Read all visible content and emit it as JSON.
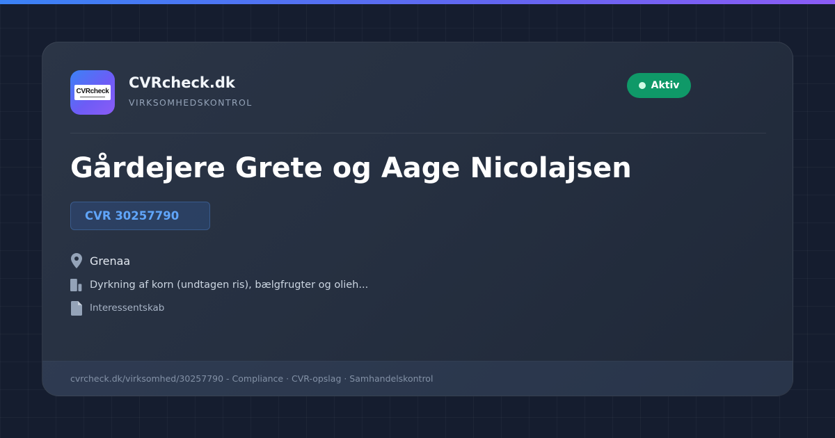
{
  "brand": {
    "logo_text": "CVRcheck",
    "name": "CVRcheck.dk",
    "tagline": "VIRKSOMHEDSKONTROL"
  },
  "status": {
    "label": "Aktiv",
    "color": "#0f9968"
  },
  "company": {
    "name": "Gårdejere Grete og Aage Nicolajsen",
    "cvr": "CVR 30257790",
    "city": "Grenaa",
    "industry": "Dyrkning af korn (undtagen ris), bælgfrugter og olieh...",
    "type": "Interessentskab"
  },
  "footer": {
    "text": "cvrcheck.dk/virksomhed/30257790 - Compliance · CVR-opslag · Samhandelskontrol"
  },
  "icons": {
    "city": "map-pin-icon",
    "industry": "building-icon",
    "type": "document-icon"
  },
  "colors": {
    "accent": "#60a5fa",
    "background": "#151d2f",
    "card": "#263041"
  }
}
